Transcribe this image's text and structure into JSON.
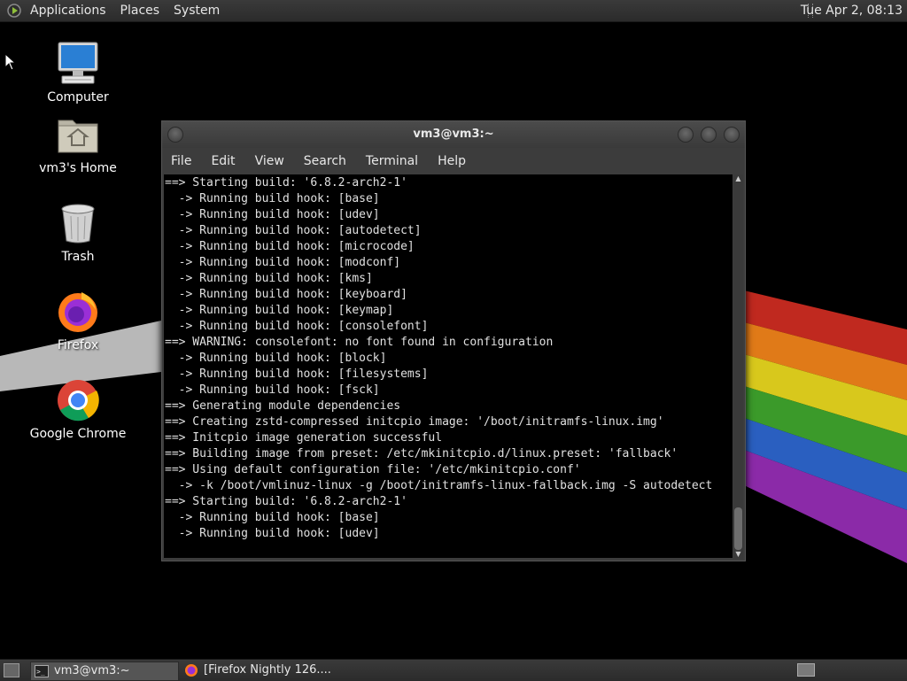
{
  "top_panel": {
    "menus": [
      "Applications",
      "Places",
      "System"
    ],
    "clock": "Tue Apr  2, 08:13"
  },
  "desktop_icons": [
    {
      "label": "Computer",
      "icon": "computer-icon"
    },
    {
      "label": "vm3's Home",
      "icon": "home-folder-icon"
    },
    {
      "label": "Trash",
      "icon": "trash-icon"
    },
    {
      "label": "Firefox",
      "icon": "firefox-icon"
    },
    {
      "label": "Google Chrome",
      "icon": "chrome-icon"
    }
  ],
  "terminal": {
    "title": "vm3@vm3:~",
    "menu": [
      "File",
      "Edit",
      "View",
      "Search",
      "Terminal",
      "Help"
    ],
    "lines": [
      "==> Starting build: '6.8.2-arch2-1'",
      "  -> Running build hook: [base]",
      "  -> Running build hook: [udev]",
      "  -> Running build hook: [autodetect]",
      "  -> Running build hook: [microcode]",
      "  -> Running build hook: [modconf]",
      "  -> Running build hook: [kms]",
      "  -> Running build hook: [keyboard]",
      "  -> Running build hook: [keymap]",
      "  -> Running build hook: [consolefont]",
      "==> WARNING: consolefont: no font found in configuration",
      "  -> Running build hook: [block]",
      "  -> Running build hook: [filesystems]",
      "  -> Running build hook: [fsck]",
      "==> Generating module dependencies",
      "==> Creating zstd-compressed initcpio image: '/boot/initramfs-linux.img'",
      "==> Initcpio image generation successful",
      "==> Building image from preset: /etc/mkinitcpio.d/linux.preset: 'fallback'",
      "==> Using default configuration file: '/etc/mkinitcpio.conf'",
      "  -> -k /boot/vmlinuz-linux -g /boot/initramfs-linux-fallback.img -S autodetect",
      "==> Starting build: '6.8.2-arch2-1'",
      "  -> Running build hook: [base]",
      "  -> Running build hook: [udev]"
    ]
  },
  "taskbar": {
    "tasks": [
      {
        "label": "vm3@vm3:~",
        "icon": "terminal-icon",
        "active": true
      },
      {
        "label": "[Firefox Nightly 126....",
        "icon": "firefox-icon",
        "active": false
      }
    ]
  },
  "colors": {
    "panel": "#2f2f2f",
    "terminal_bg": "#000000",
    "terminal_fg": "#e0e0e0"
  }
}
